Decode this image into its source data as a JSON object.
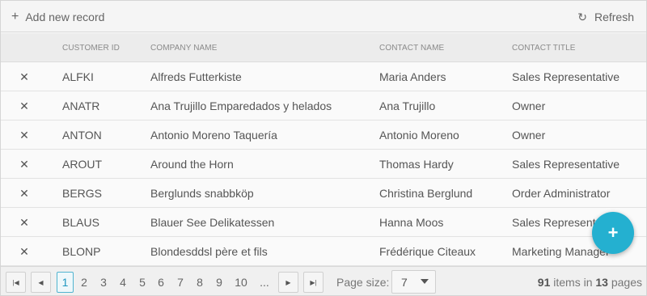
{
  "toolbar": {
    "add_icon": "+",
    "add_label": "Add new record",
    "refresh_icon": "↻",
    "refresh_label": "Refresh"
  },
  "columns": {
    "customer_id": "CUSTOMER ID",
    "company_name": "COMPANY NAME",
    "contact_name": "CONTACT NAME",
    "contact_title": "CONTACT TITLE"
  },
  "rows": [
    {
      "delete": "✕",
      "customer_id": "ALFKI",
      "company_name": "Alfreds Futterkiste",
      "contact_name": "Maria Anders",
      "contact_title": "Sales Representative"
    },
    {
      "delete": "✕",
      "customer_id": "ANATR",
      "company_name": "Ana Trujillo Emparedados y helados",
      "contact_name": "Ana Trujillo",
      "contact_title": "Owner"
    },
    {
      "delete": "✕",
      "customer_id": "ANTON",
      "company_name": "Antonio Moreno Taquería",
      "contact_name": "Antonio Moreno",
      "contact_title": "Owner"
    },
    {
      "delete": "✕",
      "customer_id": "AROUT",
      "company_name": "Around the Horn",
      "contact_name": "Thomas Hardy",
      "contact_title": "Sales Representative"
    },
    {
      "delete": "✕",
      "customer_id": "BERGS",
      "company_name": "Berglunds snabbköp",
      "contact_name": "Christina Berglund",
      "contact_title": "Order Administrator"
    },
    {
      "delete": "✕",
      "customer_id": "BLAUS",
      "company_name": "Blauer See Delikatessen",
      "contact_name": "Hanna Moos",
      "contact_title": "Sales Representative"
    },
    {
      "delete": "✕",
      "customer_id": "BLONP",
      "company_name": "Blondesddsl père et fils",
      "contact_name": "Frédérique Citeaux",
      "contact_title": "Marketing Manager"
    }
  ],
  "pager": {
    "first_icon": "|◀",
    "prev_icon": "◀",
    "next_icon": "▶",
    "last_icon": "▶|",
    "pages": [
      "1",
      "2",
      "3",
      "4",
      "5",
      "6",
      "7",
      "8",
      "9",
      "10",
      "..."
    ],
    "current_page": "1",
    "page_size_label": "Page size:",
    "page_size_value": "7",
    "total_items": "91",
    "items_text": "items in",
    "total_pages": "13",
    "pages_text": "pages"
  },
  "fab": {
    "icon": "+"
  },
  "colors": {
    "accent": "#24b0d0",
    "active_page_border": "#51b4d0"
  }
}
